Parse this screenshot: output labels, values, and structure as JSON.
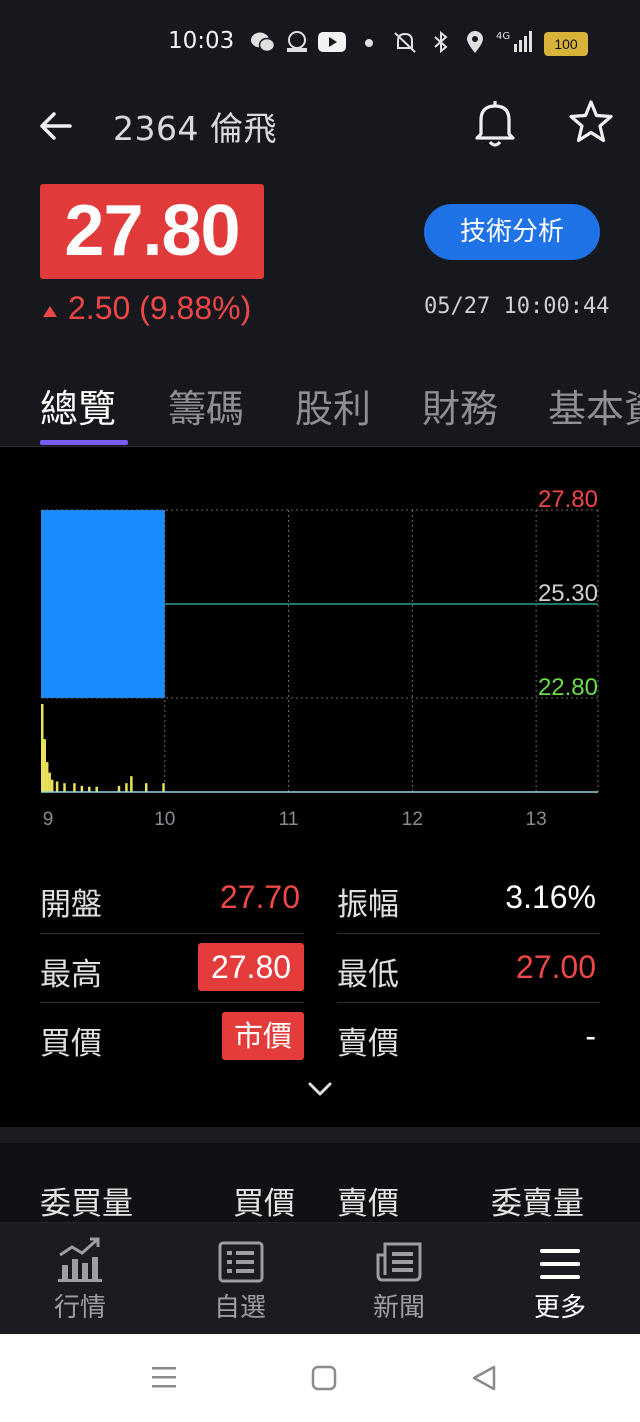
{
  "status_bar": {
    "time": "10:03",
    "battery": "100",
    "network": "4G",
    "icons": [
      "wechat-icon",
      "gomaji-icon",
      "youtube-icon",
      "dot-icon",
      "mute-icon",
      "bluetooth-icon",
      "location-icon",
      "signal-icon",
      "battery-icon"
    ]
  },
  "header": {
    "title": "2364 倫飛",
    "icons": [
      "back-arrow-icon",
      "bell-icon",
      "star-icon"
    ]
  },
  "quote": {
    "price": "27.80",
    "change": "2.50 (9.88%)",
    "datetime": "05/27 10:00:44",
    "technical_button": "技術分析",
    "colors": {
      "up": "#ef4747",
      "down": "#5ed048",
      "accent": "#1f73e6",
      "tab_indicator": "#7b5cf0"
    }
  },
  "tabs": [
    {
      "label": "總覽",
      "active": true
    },
    {
      "label": "籌碼",
      "active": false
    },
    {
      "label": "股利",
      "active": false
    },
    {
      "label": "財務",
      "active": false
    },
    {
      "label": "基本資",
      "active": false
    }
  ],
  "chart_data": {
    "type": "area",
    "price_labels": {
      "high": "27.80",
      "ref": "25.30",
      "low": "22.80"
    },
    "ylim": [
      22.8,
      27.8
    ],
    "reference": 25.3,
    "x_ticks": [
      "9",
      "10",
      "11",
      "12",
      "13"
    ],
    "price_fill": {
      "x_start": 9.0,
      "x_end": 10.0,
      "from": 22.8,
      "to": 27.8,
      "color": "#1a8cff"
    },
    "volume_bars": [
      {
        "t": 9.0,
        "v": 1.0
      },
      {
        "t": 9.02,
        "v": 0.6
      },
      {
        "t": 9.04,
        "v": 0.34
      },
      {
        "t": 9.06,
        "v": 0.22
      },
      {
        "t": 9.08,
        "v": 0.14
      },
      {
        "t": 9.12,
        "v": 0.12
      },
      {
        "t": 9.18,
        "v": 0.1
      },
      {
        "t": 9.26,
        "v": 0.1
      },
      {
        "t": 9.32,
        "v": 0.07
      },
      {
        "t": 9.38,
        "v": 0.06
      },
      {
        "t": 9.44,
        "v": 0.06
      },
      {
        "t": 9.62,
        "v": 0.07
      },
      {
        "t": 9.68,
        "v": 0.1
      },
      {
        "t": 9.72,
        "v": 0.18
      },
      {
        "t": 9.84,
        "v": 0.1
      },
      {
        "t": 9.98,
        "v": 0.1
      }
    ]
  },
  "stats": {
    "open_label": "開盤",
    "open_value": "27.70",
    "amplitude_label": "振幅",
    "amplitude_value": "3.16%",
    "high_label": "最高",
    "high_value": "27.80",
    "low_label": "最低",
    "low_value": "27.00",
    "bid_label": "買價",
    "bid_value": "市價",
    "ask_label": "賣價",
    "ask_value": "-"
  },
  "order_book": {
    "bid_volume": "委買量",
    "bid_price": "買價",
    "ask_price": "賣價",
    "ask_volume": "委賣量"
  },
  "bottom_nav": [
    {
      "label": "行情",
      "icon": "market-chart-icon",
      "active": false
    },
    {
      "label": "自選",
      "icon": "watchlist-icon",
      "active": false
    },
    {
      "label": "新聞",
      "icon": "news-icon",
      "active": false
    },
    {
      "label": "更多",
      "icon": "menu-icon",
      "active": true
    }
  ],
  "system_nav": [
    "recent-apps-icon",
    "home-icon",
    "back-triangle-icon"
  ]
}
